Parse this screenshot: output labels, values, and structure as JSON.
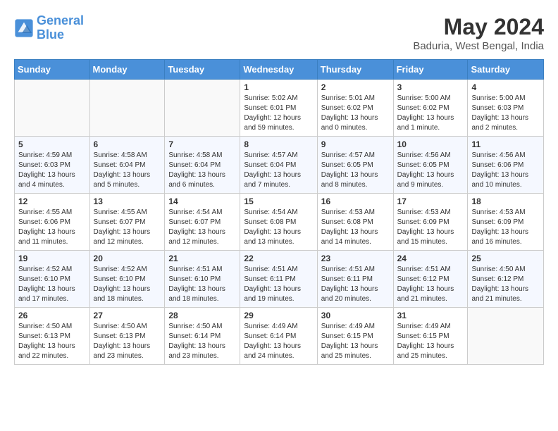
{
  "header": {
    "logo_line1": "General",
    "logo_line2": "Blue",
    "title": "May 2024",
    "subtitle": "Baduria, West Bengal, India"
  },
  "days_of_week": [
    "Sunday",
    "Monday",
    "Tuesday",
    "Wednesday",
    "Thursday",
    "Friday",
    "Saturday"
  ],
  "weeks": [
    [
      {
        "day": "",
        "info": ""
      },
      {
        "day": "",
        "info": ""
      },
      {
        "day": "",
        "info": ""
      },
      {
        "day": "1",
        "info": "Sunrise: 5:02 AM\nSunset: 6:01 PM\nDaylight: 12 hours and 59 minutes."
      },
      {
        "day": "2",
        "info": "Sunrise: 5:01 AM\nSunset: 6:02 PM\nDaylight: 13 hours and 0 minutes."
      },
      {
        "day": "3",
        "info": "Sunrise: 5:00 AM\nSunset: 6:02 PM\nDaylight: 13 hours and 1 minute."
      },
      {
        "day": "4",
        "info": "Sunrise: 5:00 AM\nSunset: 6:03 PM\nDaylight: 13 hours and 2 minutes."
      }
    ],
    [
      {
        "day": "5",
        "info": "Sunrise: 4:59 AM\nSunset: 6:03 PM\nDaylight: 13 hours and 4 minutes."
      },
      {
        "day": "6",
        "info": "Sunrise: 4:58 AM\nSunset: 6:04 PM\nDaylight: 13 hours and 5 minutes."
      },
      {
        "day": "7",
        "info": "Sunrise: 4:58 AM\nSunset: 6:04 PM\nDaylight: 13 hours and 6 minutes."
      },
      {
        "day": "8",
        "info": "Sunrise: 4:57 AM\nSunset: 6:04 PM\nDaylight: 13 hours and 7 minutes."
      },
      {
        "day": "9",
        "info": "Sunrise: 4:57 AM\nSunset: 6:05 PM\nDaylight: 13 hours and 8 minutes."
      },
      {
        "day": "10",
        "info": "Sunrise: 4:56 AM\nSunset: 6:05 PM\nDaylight: 13 hours and 9 minutes."
      },
      {
        "day": "11",
        "info": "Sunrise: 4:56 AM\nSunset: 6:06 PM\nDaylight: 13 hours and 10 minutes."
      }
    ],
    [
      {
        "day": "12",
        "info": "Sunrise: 4:55 AM\nSunset: 6:06 PM\nDaylight: 13 hours and 11 minutes."
      },
      {
        "day": "13",
        "info": "Sunrise: 4:55 AM\nSunset: 6:07 PM\nDaylight: 13 hours and 12 minutes."
      },
      {
        "day": "14",
        "info": "Sunrise: 4:54 AM\nSunset: 6:07 PM\nDaylight: 13 hours and 12 minutes."
      },
      {
        "day": "15",
        "info": "Sunrise: 4:54 AM\nSunset: 6:08 PM\nDaylight: 13 hours and 13 minutes."
      },
      {
        "day": "16",
        "info": "Sunrise: 4:53 AM\nSunset: 6:08 PM\nDaylight: 13 hours and 14 minutes."
      },
      {
        "day": "17",
        "info": "Sunrise: 4:53 AM\nSunset: 6:09 PM\nDaylight: 13 hours and 15 minutes."
      },
      {
        "day": "18",
        "info": "Sunrise: 4:53 AM\nSunset: 6:09 PM\nDaylight: 13 hours and 16 minutes."
      }
    ],
    [
      {
        "day": "19",
        "info": "Sunrise: 4:52 AM\nSunset: 6:10 PM\nDaylight: 13 hours and 17 minutes."
      },
      {
        "day": "20",
        "info": "Sunrise: 4:52 AM\nSunset: 6:10 PM\nDaylight: 13 hours and 18 minutes."
      },
      {
        "day": "21",
        "info": "Sunrise: 4:51 AM\nSunset: 6:10 PM\nDaylight: 13 hours and 18 minutes."
      },
      {
        "day": "22",
        "info": "Sunrise: 4:51 AM\nSunset: 6:11 PM\nDaylight: 13 hours and 19 minutes."
      },
      {
        "day": "23",
        "info": "Sunrise: 4:51 AM\nSunset: 6:11 PM\nDaylight: 13 hours and 20 minutes."
      },
      {
        "day": "24",
        "info": "Sunrise: 4:51 AM\nSunset: 6:12 PM\nDaylight: 13 hours and 21 minutes."
      },
      {
        "day": "25",
        "info": "Sunrise: 4:50 AM\nSunset: 6:12 PM\nDaylight: 13 hours and 21 minutes."
      }
    ],
    [
      {
        "day": "26",
        "info": "Sunrise: 4:50 AM\nSunset: 6:13 PM\nDaylight: 13 hours and 22 minutes."
      },
      {
        "day": "27",
        "info": "Sunrise: 4:50 AM\nSunset: 6:13 PM\nDaylight: 13 hours and 23 minutes."
      },
      {
        "day": "28",
        "info": "Sunrise: 4:50 AM\nSunset: 6:14 PM\nDaylight: 13 hours and 23 minutes."
      },
      {
        "day": "29",
        "info": "Sunrise: 4:49 AM\nSunset: 6:14 PM\nDaylight: 13 hours and 24 minutes."
      },
      {
        "day": "30",
        "info": "Sunrise: 4:49 AM\nSunset: 6:15 PM\nDaylight: 13 hours and 25 minutes."
      },
      {
        "day": "31",
        "info": "Sunrise: 4:49 AM\nSunset: 6:15 PM\nDaylight: 13 hours and 25 minutes."
      },
      {
        "day": "",
        "info": ""
      }
    ]
  ]
}
